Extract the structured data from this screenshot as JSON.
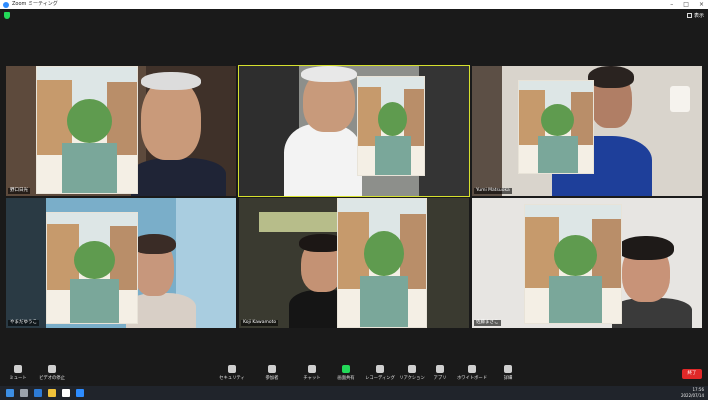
{
  "window": {
    "title": "Zoom ミーティング",
    "view_label": "表示"
  },
  "participants": [
    {
      "id": "p1",
      "name": "野口日光",
      "active": false
    },
    {
      "id": "p2",
      "name": "",
      "active": true
    },
    {
      "id": "p3",
      "name": "Yumi Matsuoka",
      "active": false
    },
    {
      "id": "p4",
      "name": "やまだゆうこ",
      "active": false
    },
    {
      "id": "p5",
      "name": "Koji Kawamoto",
      "active": false
    },
    {
      "id": "p6",
      "name": "佐藤まさこ",
      "active": false
    }
  ],
  "toolbar": {
    "mute": "ミュート",
    "video": "ビデオの停止",
    "security": "セキュリティ",
    "participants": "参加者",
    "participant_count": "6",
    "chat": "チャット",
    "share": "画面共有",
    "record": "レコーディング",
    "reactions": "リアクション",
    "apps": "アプリ",
    "whiteboard": "ホワイトボード",
    "more": "詳細",
    "end": "終了"
  },
  "taskbar": {
    "time": "17:56",
    "date": "2022/07/14"
  },
  "colors": {
    "share": "#23d959",
    "end": "#e02828",
    "active_outline": "#d6e12e",
    "zoom_blue": "#2d8cff"
  }
}
